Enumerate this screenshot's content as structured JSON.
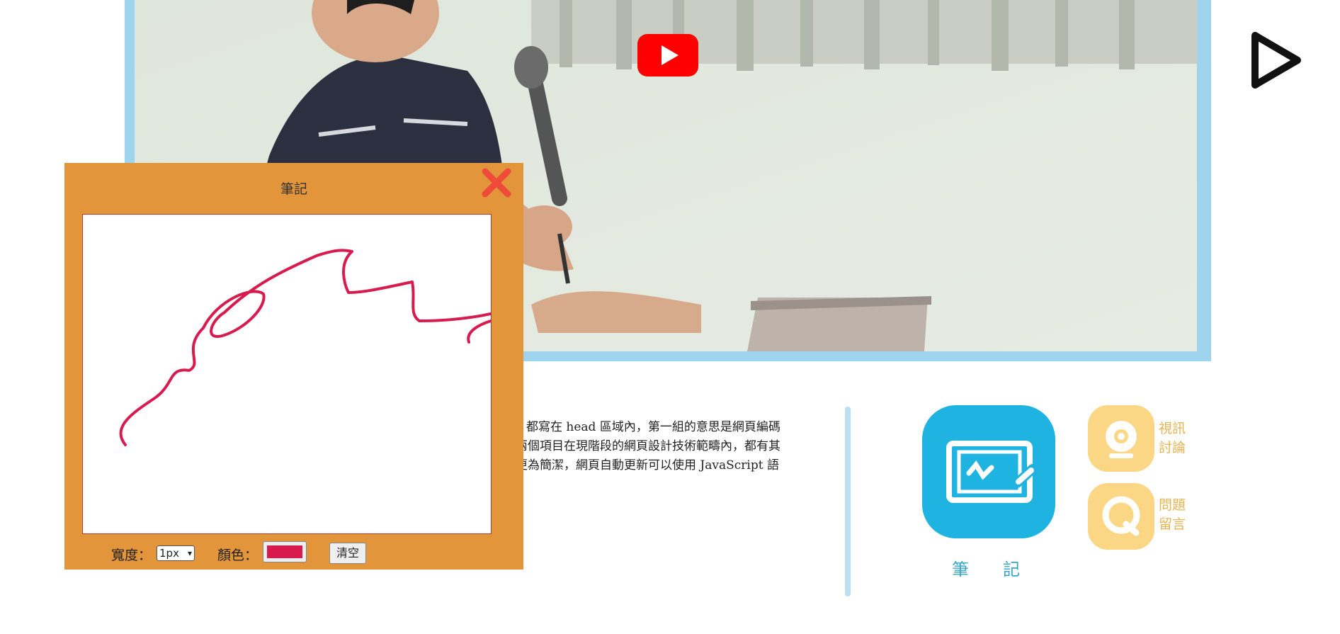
{
  "video": {
    "play_icon": "youtube-play-icon",
    "next_icon": "play-outline-icon"
  },
  "article": {
    "lines": [
      "v 都寫在 head 區域內，第一組的意思是網頁編碼",
      "兩個項目在現階段的網頁設計技術範疇內，都有其",
      "更為簡潔，網頁自動更新可以使用 JavaScript 語"
    ]
  },
  "features": {
    "note_label": "筆記",
    "video_discuss_label": [
      "視訊",
      "討論"
    ],
    "question_label": [
      "問題",
      "留言"
    ]
  },
  "notes_panel": {
    "title": "筆記",
    "width_label": "寬度：",
    "width_value": "1px",
    "color_label": "顏色：",
    "color_value": "#d81b4f",
    "clear_label": "清空",
    "accent": "#e2953a"
  }
}
